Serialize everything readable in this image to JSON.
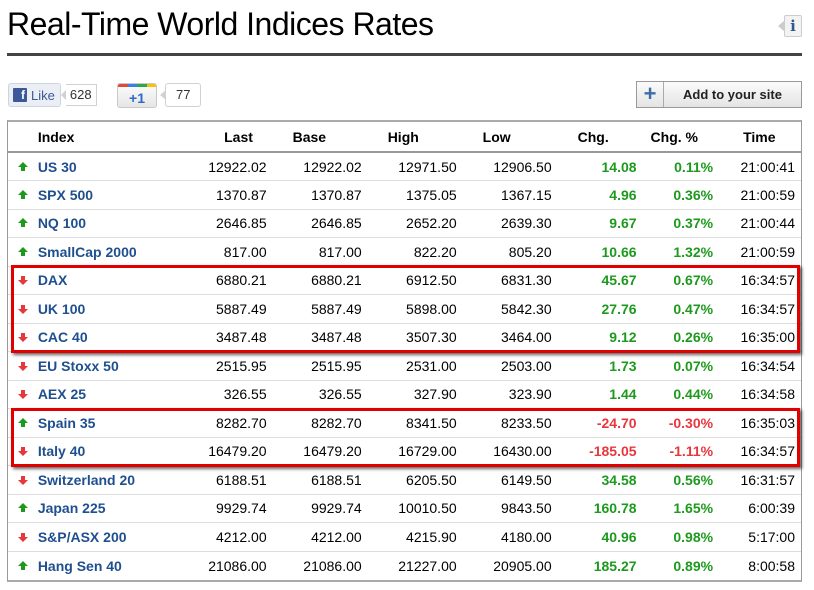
{
  "page": {
    "title": "Real-Time World Indices Rates",
    "info_icon": "info-icon"
  },
  "social": {
    "facebook": {
      "label": "Like",
      "count": "628",
      "icon": "facebook-icon"
    },
    "google_plus": {
      "label": "+1",
      "count": "77",
      "colors": [
        "#dd4b39",
        "#3b7fe8",
        "#2aa84a",
        "#f4c20d"
      ]
    }
  },
  "actions": {
    "add_to_site_label": "Add to your site",
    "add_icon": "plus-icon"
  },
  "colors": {
    "up": "#1d9a1d",
    "down": "#e8373c",
    "name": "#1f4f8f",
    "highlight": "#e10000"
  },
  "table": {
    "columns": [
      "Index",
      "Last",
      "Base",
      "High",
      "Low",
      "Chg.",
      "Chg. %",
      "Time"
    ],
    "rows": [
      {
        "dir": "up",
        "name": "US 30",
        "last": "12922.02",
        "base": "12922.02",
        "high": "12971.50",
        "low": "12906.50",
        "chg": "14.08",
        "pct": "0.11%",
        "time": "21:00:41",
        "chg_dir": "up"
      },
      {
        "dir": "up",
        "name": "SPX 500",
        "last": "1370.87",
        "base": "1370.87",
        "high": "1375.05",
        "low": "1367.15",
        "chg": "4.96",
        "pct": "0.36%",
        "time": "21:00:59",
        "chg_dir": "up"
      },
      {
        "dir": "up",
        "name": "NQ 100",
        "last": "2646.85",
        "base": "2646.85",
        "high": "2652.20",
        "low": "2639.30",
        "chg": "9.67",
        "pct": "0.37%",
        "time": "21:00:44",
        "chg_dir": "up"
      },
      {
        "dir": "up",
        "name": "SmallCap 2000",
        "last": "817.00",
        "base": "817.00",
        "high": "822.20",
        "low": "805.20",
        "chg": "10.66",
        "pct": "1.32%",
        "time": "21:00:59",
        "chg_dir": "up"
      },
      {
        "dir": "down",
        "name": "DAX",
        "last": "6880.21",
        "base": "6880.21",
        "high": "6912.50",
        "low": "6831.30",
        "chg": "45.67",
        "pct": "0.67%",
        "time": "16:34:57",
        "chg_dir": "up"
      },
      {
        "dir": "down",
        "name": "UK 100",
        "last": "5887.49",
        "base": "5887.49",
        "high": "5898.00",
        "low": "5842.30",
        "chg": "27.76",
        "pct": "0.47%",
        "time": "16:34:57",
        "chg_dir": "up"
      },
      {
        "dir": "down",
        "name": "CAC 40",
        "last": "3487.48",
        "base": "3487.48",
        "high": "3507.30",
        "low": "3464.00",
        "chg": "9.12",
        "pct": "0.26%",
        "time": "16:35:00",
        "chg_dir": "up"
      },
      {
        "dir": "down",
        "name": "EU Stoxx 50",
        "last": "2515.95",
        "base": "2515.95",
        "high": "2531.00",
        "low": "2503.00",
        "chg": "1.73",
        "pct": "0.07%",
        "time": "16:34:54",
        "chg_dir": "up"
      },
      {
        "dir": "down",
        "name": "AEX 25",
        "last": "326.55",
        "base": "326.55",
        "high": "327.90",
        "low": "323.90",
        "chg": "1.44",
        "pct": "0.44%",
        "time": "16:34:58",
        "chg_dir": "up"
      },
      {
        "dir": "up",
        "name": "Spain 35",
        "last": "8282.70",
        "base": "8282.70",
        "high": "8341.50",
        "low": "8233.50",
        "chg": "-24.70",
        "pct": "-0.30%",
        "time": "16:35:03",
        "chg_dir": "down"
      },
      {
        "dir": "down",
        "name": "Italy 40",
        "last": "16479.20",
        "base": "16479.20",
        "high": "16729.00",
        "low": "16430.00",
        "chg": "-185.05",
        "pct": "-1.11%",
        "time": "16:34:57",
        "chg_dir": "down"
      },
      {
        "dir": "down",
        "name": "Switzerland 20",
        "last": "6188.51",
        "base": "6188.51",
        "high": "6205.50",
        "low": "6149.50",
        "chg": "34.58",
        "pct": "0.56%",
        "time": "16:31:57",
        "chg_dir": "up"
      },
      {
        "dir": "up",
        "name": "Japan 225",
        "last": "9929.74",
        "base": "9929.74",
        "high": "10010.50",
        "low": "9843.50",
        "chg": "160.78",
        "pct": "1.65%",
        "time": "6:00:39",
        "chg_dir": "up"
      },
      {
        "dir": "down",
        "name": "S&P/ASX 200",
        "last": "4212.00",
        "base": "4212.00",
        "high": "4215.90",
        "low": "4180.00",
        "chg": "40.96",
        "pct": "0.98%",
        "time": "5:17:00",
        "chg_dir": "up"
      },
      {
        "dir": "up",
        "name": "Hang Sen 40",
        "last": "21086.00",
        "base": "21086.00",
        "high": "21227.00",
        "low": "20905.00",
        "chg": "185.27",
        "pct": "0.89%",
        "time": "8:00:58",
        "chg_dir": "up"
      }
    ]
  },
  "highlights": [
    {
      "label": "highlight-european-major",
      "from_row": 4,
      "to_row": 6
    },
    {
      "label": "highlight-southern-europe",
      "from_row": 9,
      "to_row": 10
    }
  ]
}
